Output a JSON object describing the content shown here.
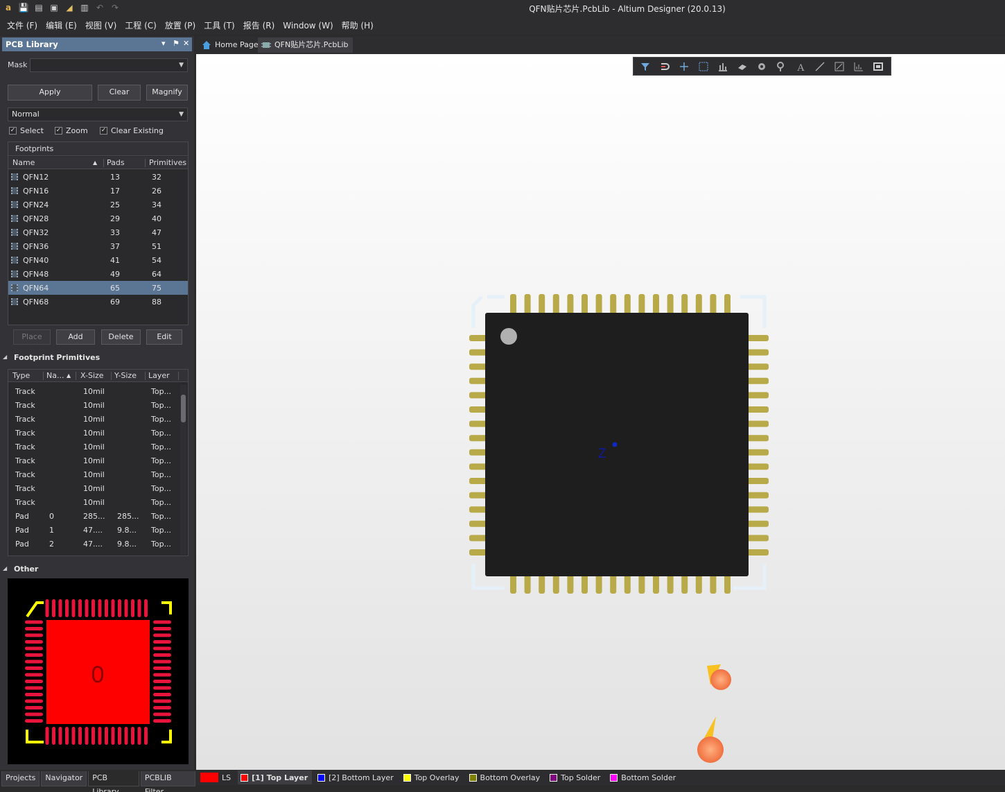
{
  "window": {
    "title": "QFN贴片芯片.PcbLib - Altium Designer (20.0.13)"
  },
  "menu": [
    "文件 (F)",
    "编辑 (E)",
    "视图 (V)",
    "工程 (C)",
    "放置 (P)",
    "工具 (T)",
    "报告 (R)",
    "Window (W)",
    "帮助 (H)"
  ],
  "panel": {
    "title": "PCB Library",
    "mask_label": "Mask",
    "mask_value": "",
    "apply": "Apply",
    "clear": "Clear",
    "magnify": "Magnify",
    "mode": "Normal",
    "select": "Select",
    "zoom": "Zoom",
    "clear_existing": "Clear Existing",
    "footprints_title": "Footprints",
    "fp_cols": [
      "Name",
      "Pads",
      "Primitives"
    ],
    "footprints": [
      {
        "name": "QFN12",
        "pads": "13",
        "prims": "32"
      },
      {
        "name": "QFN16",
        "pads": "17",
        "prims": "26"
      },
      {
        "name": "QFN24",
        "pads": "25",
        "prims": "34"
      },
      {
        "name": "QFN28",
        "pads": "29",
        "prims": "40"
      },
      {
        "name": "QFN32",
        "pads": "33",
        "prims": "47"
      },
      {
        "name": "QFN36",
        "pads": "37",
        "prims": "51"
      },
      {
        "name": "QFN40",
        "pads": "41",
        "prims": "54"
      },
      {
        "name": "QFN48",
        "pads": "49",
        "prims": "64"
      },
      {
        "name": "QFN64",
        "pads": "65",
        "prims": "75"
      },
      {
        "name": "QFN68",
        "pads": "69",
        "prims": "88"
      }
    ],
    "place": "Place",
    "add": "Add",
    "delete": "Delete",
    "edit": "Edit",
    "primitives_title": "Footprint Primitives",
    "prim_cols": [
      "Type",
      "Na...",
      "X-Size",
      "Y-Size",
      "Layer"
    ],
    "primitives": [
      {
        "type": "Track",
        "name": "",
        "x": "10mil",
        "y": "",
        "layer": "Top..."
      },
      {
        "type": "Track",
        "name": "",
        "x": "10mil",
        "y": "",
        "layer": "Top..."
      },
      {
        "type": "Track",
        "name": "",
        "x": "10mil",
        "y": "",
        "layer": "Top..."
      },
      {
        "type": "Track",
        "name": "",
        "x": "10mil",
        "y": "",
        "layer": "Top..."
      },
      {
        "type": "Track",
        "name": "",
        "x": "10mil",
        "y": "",
        "layer": "Top..."
      },
      {
        "type": "Track",
        "name": "",
        "x": "10mil",
        "y": "",
        "layer": "Top..."
      },
      {
        "type": "Track",
        "name": "",
        "x": "10mil",
        "y": "",
        "layer": "Top..."
      },
      {
        "type": "Track",
        "name": "",
        "x": "10mil",
        "y": "",
        "layer": "Top..."
      },
      {
        "type": "Track",
        "name": "",
        "x": "10mil",
        "y": "",
        "layer": "Top..."
      },
      {
        "type": "Pad",
        "name": "0",
        "x": "285...",
        "y": "285...",
        "layer": "Top..."
      },
      {
        "type": "Pad",
        "name": "1",
        "x": "47....",
        "y": "9.8...",
        "layer": "Top..."
      },
      {
        "type": "Pad",
        "name": "2",
        "x": "47....",
        "y": "9.8...",
        "layer": "Top..."
      }
    ],
    "other_title": "Other",
    "preview_label": "0"
  },
  "bottom_tabs": [
    "Projects",
    "Navigator",
    "PCB Library",
    "PCBLIB Filter"
  ],
  "doc_tabs": [
    "Home Page",
    "QFN贴片芯片.PcbLib"
  ],
  "canvas": {
    "origin_label": "Z"
  },
  "layers": {
    "ls": "LS",
    "items": [
      {
        "label": "[1] Top Layer",
        "color": "#ff0000"
      },
      {
        "label": "[2] Bottom Layer",
        "color": "#0000ff"
      },
      {
        "label": "Top Overlay",
        "color": "#ffff00"
      },
      {
        "label": "Bottom Overlay",
        "color": "#808000"
      },
      {
        "label": "Top Solder",
        "color": "#800080"
      },
      {
        "label": "Bottom Solder",
        "color": "#ff00ff"
      }
    ]
  },
  "colors": {
    "accent": "#5b7594",
    "pad": "#b8aa48",
    "body": "#1e1e1e",
    "preview_pad": "#e8143c"
  }
}
